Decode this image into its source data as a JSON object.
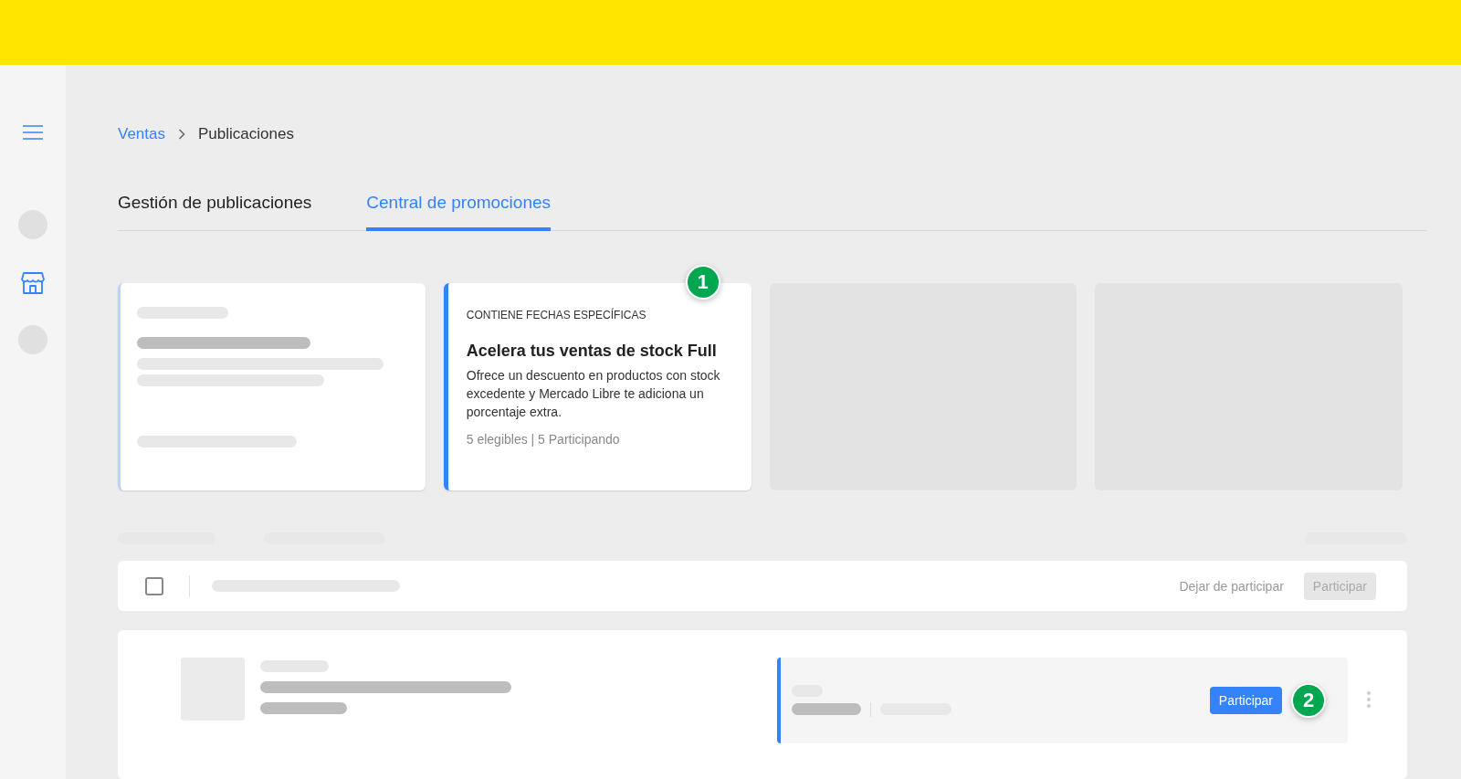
{
  "breadcrumb": [
    {
      "label": "Ventas",
      "kind": "link"
    },
    {
      "label": "Publicaciones",
      "kind": "current"
    }
  ],
  "tabs": [
    {
      "label": "Gestión de publicaciones",
      "selected": false
    },
    {
      "label": "Central de promociones",
      "selected": true
    }
  ],
  "promo_cards": [
    {
      "kind": "skeleton"
    },
    {
      "kind": "promo",
      "tag": "CONTIENE FECHAS ESPECÍFICAS",
      "title": "Acelera tus ventas de stock Full",
      "description": "Ofrece un descuento en productos con stock excedente y Mercado Libre te adiciona un porcentaje extra.",
      "stats": "5 elegibles | 5 Participando",
      "marker": "1"
    },
    {
      "kind": "placeholder"
    },
    {
      "kind": "placeholder"
    }
  ],
  "bulk_bar": {
    "checked": false,
    "secondary_action": "Dejar de participar",
    "primary_action": {
      "label": "Participar",
      "disabled": true
    }
  },
  "listing": {
    "action": {
      "label": "Participar",
      "disabled": false
    },
    "marker": "2"
  }
}
